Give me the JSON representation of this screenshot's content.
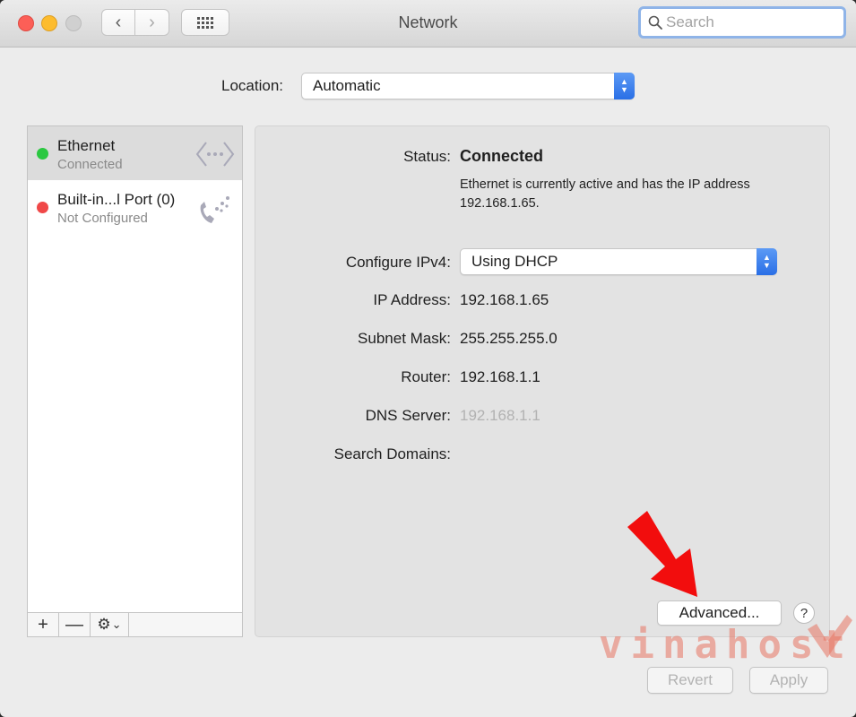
{
  "window": {
    "title": "Network"
  },
  "toolbar": {
    "back_glyph": "‹",
    "forward_glyph": "›",
    "grid_icon": "grid-icon",
    "search_placeholder": "Search"
  },
  "location": {
    "label": "Location:",
    "value": "Automatic"
  },
  "services": [
    {
      "name": "Ethernet",
      "status": "Connected",
      "status_color": "#2bc841",
      "icon": "ethernet-icon",
      "selected": true
    },
    {
      "name": "Built-in...l Port (0)",
      "status": "Not Configured",
      "status_color": "#f04848",
      "icon": "phone-icon",
      "selected": false
    }
  ],
  "sidebar_controls": {
    "add": "+",
    "remove": "—",
    "gear_glyph": "⚙",
    "caret": "⌄"
  },
  "detail": {
    "status_label": "Status:",
    "status_value": "Connected",
    "status_description": "Ethernet is currently active and has the IP address 192.168.1.65.",
    "configure_label": "Configure IPv4:",
    "configure_value": "Using DHCP",
    "ip_label": "IP Address:",
    "ip_value": "192.168.1.65",
    "subnet_label": "Subnet Mask:",
    "subnet_value": "255.255.255.0",
    "router_label": "Router:",
    "router_value": "192.168.1.1",
    "dns_label": "DNS Server:",
    "dns_value": "192.168.1.1",
    "search_domains_label": "Search Domains:"
  },
  "buttons": {
    "advanced": "Advanced...",
    "help": "?",
    "revert": "Revert",
    "apply": "Apply"
  },
  "overlay": {
    "watermark": "vinahost.",
    "arrow_color": "#f20d0d"
  }
}
